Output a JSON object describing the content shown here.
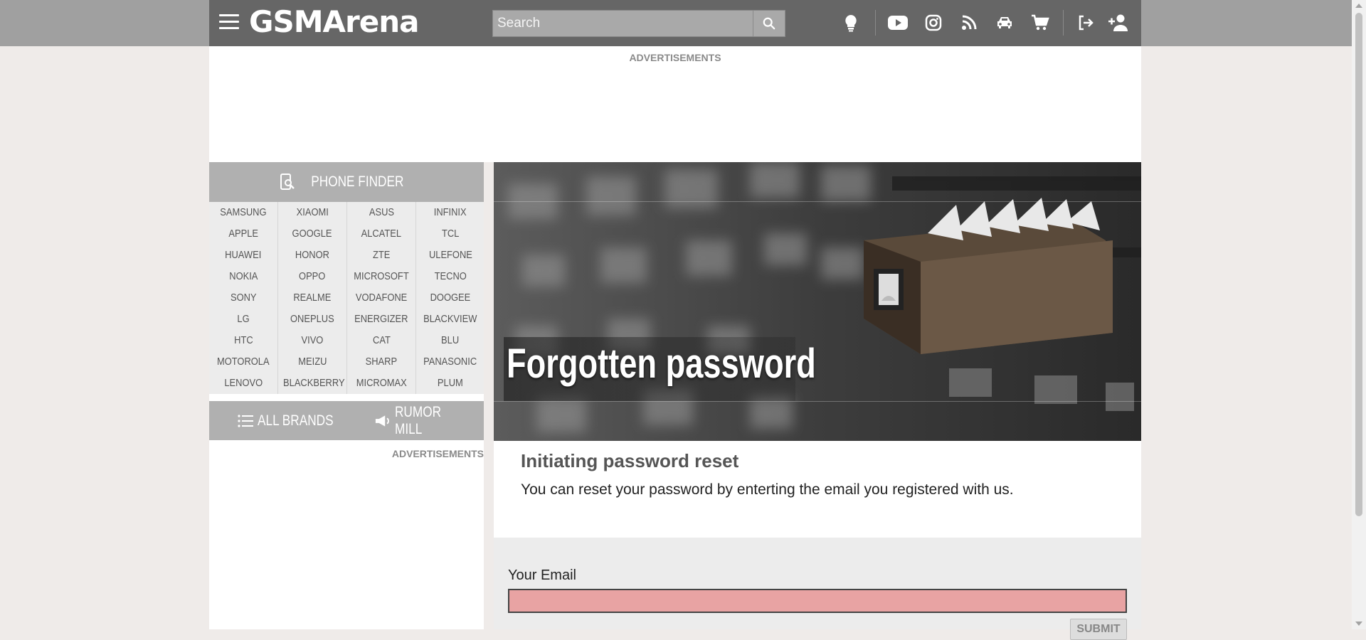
{
  "header": {
    "logo": "GSMArena",
    "search_placeholder": "Search",
    "icons": [
      "menu-icon",
      "search-icon",
      "lightbulb-icon",
      "youtube-icon",
      "instagram-icon",
      "rss-icon",
      "car-icon",
      "cart-icon",
      "login-icon",
      "add-user-icon"
    ]
  },
  "ads": {
    "top_label": "ADVERTISEMENTS",
    "side_label": "ADVERTISEMENTS"
  },
  "phone_finder": {
    "title": "PHONE FINDER",
    "brands": [
      [
        "SAMSUNG",
        "APPLE",
        "HUAWEI",
        "NOKIA",
        "SONY",
        "LG",
        "HTC",
        "MOTOROLA",
        "LENOVO"
      ],
      [
        "XIAOMI",
        "GOOGLE",
        "HONOR",
        "OPPO",
        "REALME",
        "ONEPLUS",
        "VIVO",
        "MEIZU",
        "BLACKBERRY"
      ],
      [
        "ASUS",
        "ALCATEL",
        "ZTE",
        "MICROSOFT",
        "VODAFONE",
        "ENERGIZER",
        "CAT",
        "SHARP",
        "MICROMAX"
      ],
      [
        "INFINIX",
        "TCL",
        "ULEFONE",
        "TECNO",
        "DOOGEE",
        "BLACKVIEW",
        "BLU",
        "PANASONIC",
        "PLUM"
      ]
    ],
    "all_brands": "ALL BRANDS",
    "rumor_mill": "RUMOR MILL"
  },
  "main": {
    "hero_title": "Forgotten password",
    "section_title": "Initiating password reset",
    "section_desc": "You can reset your password by enterting the email you registered with us.",
    "email_label": "Your Email",
    "email_value": "",
    "submit_label": "SUBMIT"
  },
  "colors": {
    "header": "#666666",
    "sidebar_header": "#b0b0b0",
    "email_field": "#e8a3a3",
    "page_bg": "#efebe9"
  }
}
